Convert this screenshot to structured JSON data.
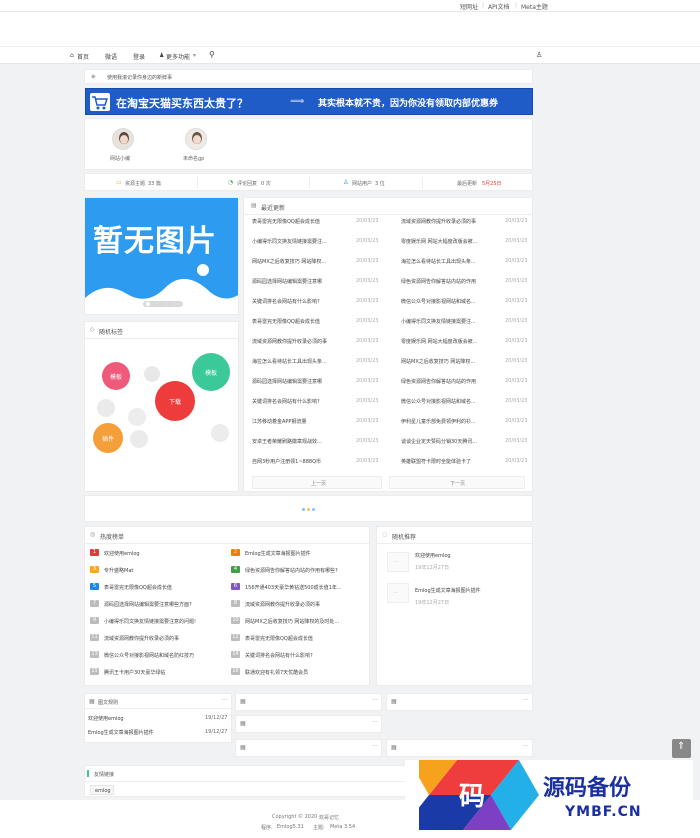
{
  "topbar": {
    "links": [
      "短网址",
      "API文档",
      "Meta主题"
    ]
  },
  "nav": {
    "home": "首页",
    "weiyu": "微语",
    "login": "登录",
    "more": "更多功能"
  },
  "notice": {
    "text": "使用我滚记录你身边的新鲜事"
  },
  "banner": {
    "text": "在淘宝天猫买东西太贵了？",
    "text2": "其实根本就不贵，因为你没有领取内部优惠券",
    "color": "#1f5cc8"
  },
  "users": [
    {
      "name": "网站小编"
    },
    {
      "name": "未命名gp"
    }
  ],
  "stats": {
    "posts_label": "资源主题",
    "posts_value": "33 篇",
    "comments_label": "评论回复",
    "comments_value": "0 次",
    "users_label": "网站用户",
    "users_value": "3 位",
    "update_label": "最后更新",
    "update_value": "5月25日"
  },
  "slider": {
    "text": "暂无图片",
    "color": "#2d9cf0"
  },
  "tags": {
    "title": "随机标签",
    "items": [
      "模板",
      "模板",
      "下载",
      "插件"
    ],
    "colors": [
      "#ef5a7a",
      "#3cc99a",
      "#ee3b3b",
      "#f59f3a"
    ]
  },
  "recent": {
    "title": "最近更新",
    "left": [
      "表哥雷完无限像QQ超会成长值",
      "小编得乐同文换友情链接需要注...",
      "网站MX之后收复技巧 网站降权...",
      "源码园选择网站编辑需要注意哪",
      "关键词排名会网站有什么影响?",
      "表哥雷完无限像QQ超会成长值",
      "流域资源网教你提升收录必须的事",
      "海拉怎么看待站长工具出现头条...",
      "源码园选择网站编辑需要注意哪",
      "关键词排名会网站有什么影响?",
      "江苏移动着金APP钢流量",
      "安卓王者荣耀刷路徽章观战效...",
      "自网3秒用户注册领1~888Q币"
    ],
    "right": [
      "流域资源网教你提升收录必须的事",
      "零度娱乐网 网站大幅度改版会被...",
      "海拉怎么看待站长工具出现头条...",
      "绿色资源网告你解答站内站的作用",
      "微信公众号对接影视网站和域名...",
      "小编得乐同文换友情链接需要注...",
      "零度娱乐网 网站大幅度改版会被...",
      "网站MX之后收复技巧 网站降权...",
      "绿色资源网告你解答站内站的作用",
      "微信公众号对接影视网站和域名...",
      "伊利星儿童乐部免费领伊利的衫...",
      "谈谈企业定天赞码分销30天腾讯...",
      "英雄联盟符卡限时全能体验卡了"
    ],
    "date": "20/03/23",
    "prev": "上一页",
    "next": "下一页"
  },
  "hot": {
    "title": "热度榜单",
    "left": [
      "欢迎使用emlog",
      "专升盛略Mat",
      "表哥雷完无限像QQ超会成长值",
      "源码园选择网站编辑需要注意哪些方面?",
      "小编得乐同文换友情链接需要注意的问题!",
      "流域资源网教你提升收录必须的事",
      "微信公众号对接影视网站和域名防红技巧",
      "腾讯王卡用户30天豪华绿钻"
    ],
    "right": [
      "Emlog生成文章海报图片插件",
      "绿色资源网告你解答站内站的作用有哪些?",
      "156开通403天豪华黄钻送500成长值1年...",
      "流域资源网教你提升收录必须的事",
      "网站MX之后收复技巧 网站降权的及时处...",
      "表哥雷完无限像QQ超会成长值",
      "关键词排名会网站有什么影响?",
      "联通欢迎有礼领7天优酷会员"
    ],
    "badge_colors": [
      "#e53935",
      "#f57c00",
      "#f9a825",
      "#43a047",
      "#1e88e5",
      "#7e57c2",
      "#bdbdbd"
    ]
  },
  "random_rec": {
    "title": "随机推荐",
    "items": [
      {
        "title": "欢迎使用emlog",
        "date": "19年12月27日"
      },
      {
        "title": "Emlog生成文章海报图片插件",
        "date": "19年12月27日"
      }
    ]
  },
  "graphic": {
    "title": "图文规则",
    "items": [
      {
        "title": "欢迎使用emlog",
        "date": "19/12/27"
      },
      {
        "title": "Emlog生成文章海报图片插件",
        "date": "19/12/27"
      }
    ]
  },
  "friends": {
    "title": "友情链接",
    "items": [
      "emlog"
    ]
  },
  "footer": {
    "copy": "Copyright © 2020",
    "site": "欢哥记忆",
    "prog_label": "程序:",
    "prog": "Emlog5.31",
    "theme_label": "主题:",
    "theme": "Meta 3.54"
  },
  "watermark": {
    "big": "源码备份",
    "small": "YMBF.CN",
    "glyph": "码"
  }
}
